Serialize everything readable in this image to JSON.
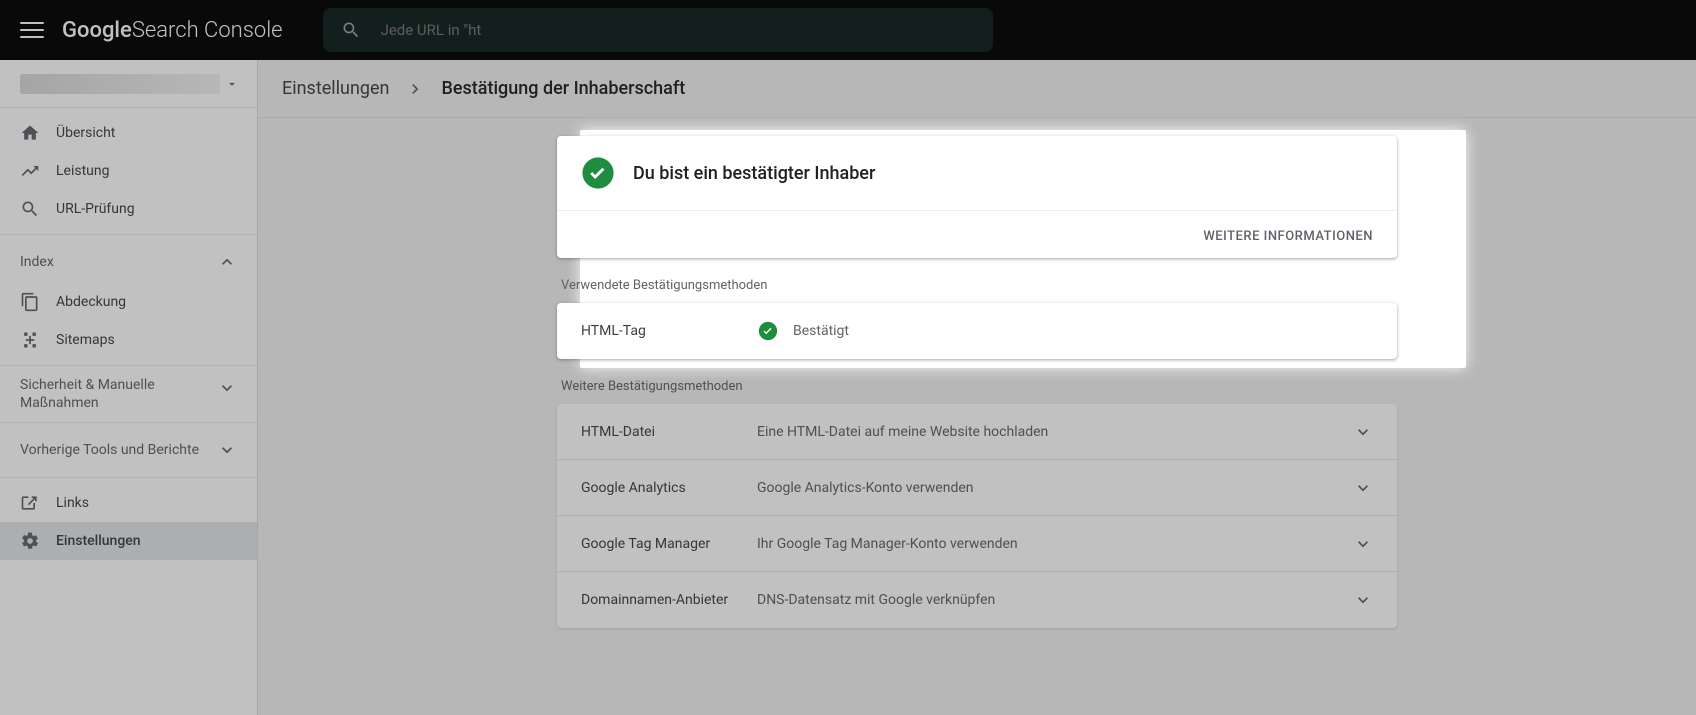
{
  "app": {
    "logo1": "Google",
    "logo2": " Search Console"
  },
  "search": {
    "placeholder": "Jede URL in \"ht"
  },
  "sidebar": {
    "items": [
      {
        "label": "Übersicht"
      },
      {
        "label": "Leistung"
      },
      {
        "label": "URL-Prüfung"
      }
    ],
    "index_head": "Index",
    "index_items": [
      {
        "label": "Abdeckung"
      },
      {
        "label": "Sitemaps"
      }
    ],
    "sec_head": "Sicherheit & Manuelle Maßnahmen",
    "old_head": "Vorherige Tools und Berichte",
    "links_label": "Links",
    "settings_label": "Einstellungen"
  },
  "crumb": {
    "first": "Einstellungen",
    "second": "Bestätigung der Inhaberschaft"
  },
  "status": {
    "title": "Du bist ein bestätigter Inhaber",
    "more": "WEITERE INFORMATIONEN"
  },
  "used": {
    "section_title": "Verwendete Bestätigungsmethoden",
    "row_name": "HTML-Tag",
    "row_status": "Bestätigt"
  },
  "other": {
    "section_title": "Weitere Bestätigungsmethoden",
    "rows": [
      {
        "name": "HTML-Datei",
        "desc": "Eine HTML-Datei auf meine Website hochladen"
      },
      {
        "name": "Google Analytics",
        "desc": "Google Analytics-Konto verwenden"
      },
      {
        "name": "Google Tag Manager",
        "desc": "Ihr Google Tag Manager-Konto verwenden"
      },
      {
        "name": "Domainnamen-Anbieter",
        "desc": "DNS-Datensatz mit Google verknüpfen"
      }
    ]
  }
}
